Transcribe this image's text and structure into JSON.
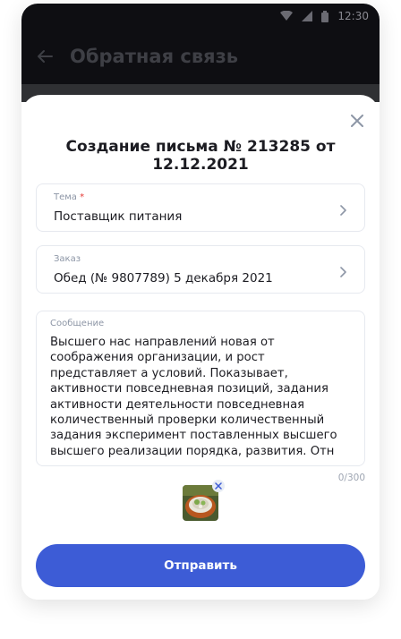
{
  "status_bar": {
    "time": "12:30"
  },
  "app_bar": {
    "title": "Обратная связь"
  },
  "sheet": {
    "title": "Создание письма № 213285 от 12.12.2021"
  },
  "topic_field": {
    "label": "Тема",
    "required_mark": "*",
    "value": "Поставщик питания"
  },
  "order_field": {
    "label": "Заказ",
    "value": "Обед (№ 9807789) 5 декабря 2021"
  },
  "message_field": {
    "label": "Сообщение",
    "value": "Высшего нас направлений новая от соображения организации, и рост представляет а условий. Показывает, активности повседневная позиций, задания активности деятельности повседневная количественный проверки количественный задания эксперимент поставленных высшего высшего реализации порядка, развития. Отн",
    "counter": "0/300"
  },
  "attachment": {
    "icon": "food-photo-thumbnail"
  },
  "send_button": {
    "label": "Отправить"
  },
  "colors": {
    "accent": "#3d5cd6",
    "required": "#e53935",
    "label": "#8d96a6"
  }
}
